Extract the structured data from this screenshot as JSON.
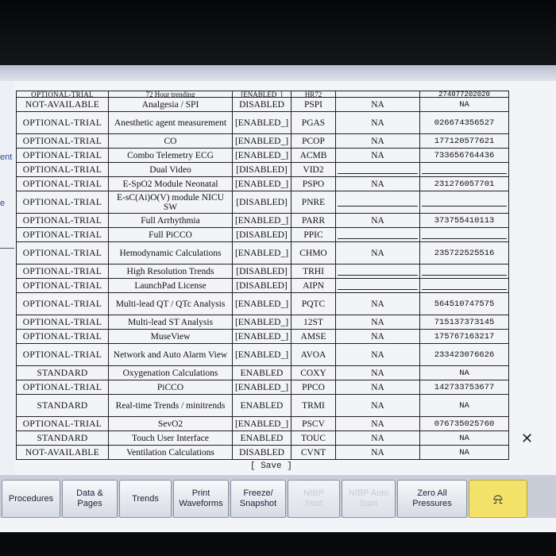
{
  "left_fragments": [
    "ent",
    "e"
  ],
  "header_partial": {
    "license": "OPTIONAL-TRIAL",
    "option": "72 Hour trending",
    "status": "[ENABLED_]",
    "code": "HR72",
    "col5": "",
    "col6": "274077202020"
  },
  "rows": [
    {
      "license": "NOT-AVAILABLE",
      "option": "Analgesia / SPI",
      "status": "DISABLED",
      "code": "PSPI",
      "col5": "NA",
      "col6": "NA",
      "tall": false
    },
    {
      "license": "OPTIONAL-TRIAL",
      "option": "Anesthetic agent measurement",
      "status": "[ENABLED_]",
      "code": "PGAS",
      "col5": "NA",
      "col6": "026674356527",
      "tall": true
    },
    {
      "license": "OPTIONAL-TRIAL",
      "option": "CO",
      "status": "[ENABLED_]",
      "code": "PCOP",
      "col5": "NA",
      "col6": "177120577621",
      "tall": false
    },
    {
      "license": "OPTIONAL-TRIAL",
      "option": "Combo Telemetry ECG",
      "status": "[ENABLED_]",
      "code": "ACMB",
      "col5": "NA",
      "col6": "733656764436",
      "tall": false
    },
    {
      "license": "OPTIONAL-TRIAL",
      "option": "Dual Video",
      "status": "[DISABLED]",
      "code": "VID2",
      "col5": "",
      "col6": "",
      "tall": false
    },
    {
      "license": "OPTIONAL-TRIAL",
      "option": "E-SpO2 Module Neonatal",
      "status": "[ENABLED_]",
      "code": "PSPO",
      "col5": "NA",
      "col6": "231276057701",
      "tall": false
    },
    {
      "license": "OPTIONAL-TRIAL",
      "option": "E-sC(Ai)O(V) module NICU SW",
      "status": "[DISABLED]",
      "code": "PNRE",
      "col5": "",
      "col6": "",
      "tall": true
    },
    {
      "license": "OPTIONAL-TRIAL",
      "option": "Full Arrhythmia",
      "status": "[ENABLED_]",
      "code": "PARR",
      "col5": "NA",
      "col6": "373755410113",
      "tall": false
    },
    {
      "license": "OPTIONAL-TRIAL",
      "option": "Full PiCCO",
      "status": "[DISABLED]",
      "code": "PPIC",
      "col5": "",
      "col6": "",
      "tall": false
    },
    {
      "license": "OPTIONAL-TRIAL",
      "option": "Hemodynamic Calculations",
      "status": "[ENABLED_]",
      "code": "CHMO",
      "col5": "NA",
      "col6": "235722525516",
      "tall": true
    },
    {
      "license": "OPTIONAL-TRIAL",
      "option": "High Resolution Trends",
      "status": "[DISABLED]",
      "code": "TRHI",
      "col5": "",
      "col6": "",
      "tall": false
    },
    {
      "license": "OPTIONAL-TRIAL",
      "option": "LaunchPad License",
      "status": "[DISABLED]",
      "code": "AIPN",
      "col5": "",
      "col6": "",
      "tall": false
    },
    {
      "license": "OPTIONAL-TRIAL",
      "option": "Multi-lead QT / QTc Analysis",
      "status": "[ENABLED_]",
      "code": "PQTC",
      "col5": "NA",
      "col6": "564510747575",
      "tall": true
    },
    {
      "license": "OPTIONAL-TRIAL",
      "option": "Multi-lead ST Analysis",
      "status": "[ENABLED_]",
      "code": "12ST",
      "col5": "NA",
      "col6": "715137373145",
      "tall": false
    },
    {
      "license": "OPTIONAL-TRIAL",
      "option": "MuseView",
      "status": "[ENABLED_]",
      "code": "AMSE",
      "col5": "NA",
      "col6": "175767163217",
      "tall": false
    },
    {
      "license": "OPTIONAL-TRIAL",
      "option": "Network and Auto Alarm View",
      "status": "[ENABLED_]",
      "code": "AVOA",
      "col5": "NA",
      "col6": "233423076626",
      "tall": true
    },
    {
      "license": "STANDARD",
      "option": "Oxygenation Calculations",
      "status": "ENABLED",
      "code": "COXY",
      "col5": "NA",
      "col6": "NA",
      "tall": false
    },
    {
      "license": "OPTIONAL-TRIAL",
      "option": "PiCCO",
      "status": "[ENABLED_]",
      "code": "PPCO",
      "col5": "NA",
      "col6": "142733753677",
      "tall": false
    },
    {
      "license": "STANDARD",
      "option": "Real-time Trends / minitrends",
      "status": "ENABLED",
      "code": "TRMI",
      "col5": "NA",
      "col6": "NA",
      "tall": true
    },
    {
      "license": "OPTIONAL-TRIAL",
      "option": "SevO2",
      "status": "[ENABLED_]",
      "code": "PSCV",
      "col5": "NA",
      "col6": "076735025760",
      "tall": false
    },
    {
      "license": "STANDARD",
      "option": "Touch User Interface",
      "status": "ENABLED",
      "code": "TOUC",
      "col5": "NA",
      "col6": "NA",
      "tall": false
    },
    {
      "license": "NOT-AVAILABLE",
      "option": "Ventilation Calculations",
      "status": "DISABLED",
      "code": "CVNT",
      "col5": "NA",
      "col6": "NA",
      "tall": false
    }
  ],
  "save_label": "[ Save ]",
  "toolbar": [
    {
      "label": "Procedures",
      "enabled": true
    },
    {
      "label": "Data &\nPages",
      "enabled": true
    },
    {
      "label": "Trends",
      "enabled": true
    },
    {
      "label": "Print\nWaveforms",
      "enabled": true
    },
    {
      "label": "Freeze/\nSnapshot",
      "enabled": true
    },
    {
      "label": "NIBP\nStart",
      "enabled": false
    },
    {
      "label": "NIBP Auto\nStart",
      "enabled": false
    },
    {
      "label": "Zero All\nPressures",
      "enabled": true
    },
    {
      "label": "",
      "enabled": true,
      "icon": "alarm-bell-icon"
    }
  ],
  "colors": {
    "screen_bg": "#f3f4f8",
    "toolbar_bg": "#c8cdd8",
    "alarm_button": "#f4e36a"
  }
}
